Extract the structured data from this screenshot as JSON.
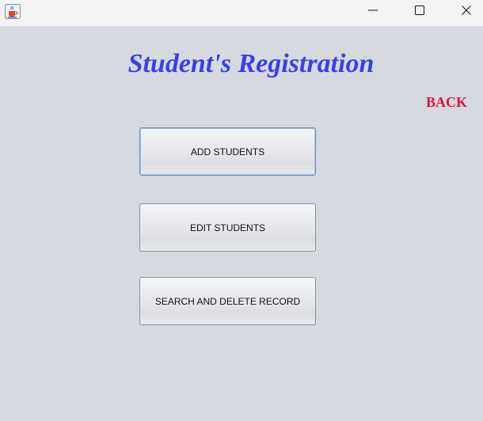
{
  "window": {
    "icon": "java-coffee-cup-icon",
    "controls": {
      "minimize": "minimize-icon",
      "maximize": "maximize-icon",
      "close": "close-icon"
    }
  },
  "main": {
    "title": "Student's Registration",
    "back_label": "BACK",
    "buttons": {
      "add": "ADD STUDENTS",
      "edit": "EDIT STUDENTS",
      "search_delete": "SEARCH AND DELETE RECORD"
    }
  },
  "colors": {
    "background": "#d6d9e0",
    "title": "#3b3fe6",
    "back": "#e0133c",
    "titlebar": "#f3f3f3"
  }
}
